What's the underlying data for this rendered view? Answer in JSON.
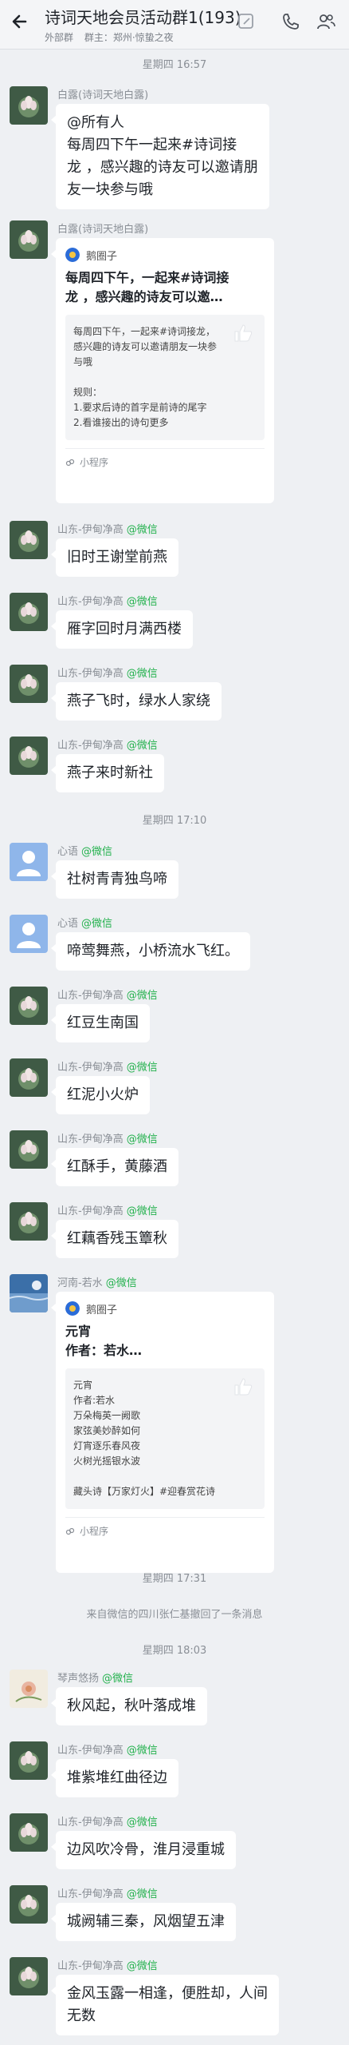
{
  "header": {
    "title": "诗词天地会员活动群1(193)",
    "subtitle_left": "外部群",
    "subtitle_right": "群主：郑州·惊蛰之夜",
    "accent": "#2b6cd8"
  },
  "timestamps": [
    "星期四 16:57",
    "星期四 17:10",
    "星期四 17:31",
    "星期四 18:03"
  ],
  "notice": "来自微信的四川张仁基撤回了一条消息",
  "wechat_tag": "@微信",
  "messages": [
    {
      "sender": "白露(诗词天地白露)",
      "text": [
        "@所有人",
        "每周四下午一起来#诗词接",
        "龙 ，感兴趣的诗友可以邀请朋",
        "友一块参与哦"
      ]
    },
    {
      "sender": "白露(诗词天地白露)",
      "card": {
        "source": "鹅圈子",
        "title": [
          "每周四下午，一起来#诗词接",
          "龙     ，感兴趣的诗友可以邀…"
        ],
        "preview": [
          "每周四下午，一起来#诗词接龙，",
          "感兴趣的诗友可以邀请朋友一块参",
          "与哦",
          "",
          "规则：",
          "1.要求后诗的首字是前诗的尾字",
          "2.看谁接出的诗句更多"
        ],
        "footer": "小程序"
      }
    },
    {
      "sender": "山东-伊甸净高",
      "text": [
        "旧时王谢堂前燕"
      ]
    },
    {
      "sender": "山东-伊甸净高",
      "text": [
        "雁字回时月满西楼"
      ]
    },
    {
      "sender": "山东-伊甸净高",
      "text": [
        "燕子飞时，绿水人家绕"
      ]
    },
    {
      "sender": "山东-伊甸净高",
      "text": [
        "燕子来时新社"
      ]
    },
    {
      "sender": "心语",
      "text": [
        "社树青青独鸟啼"
      ]
    },
    {
      "sender": "心语",
      "text": [
        "啼莺舞燕，小桥流水飞红。"
      ]
    },
    {
      "sender": "山东-伊甸净高",
      "text": [
        "红豆生南国"
      ]
    },
    {
      "sender": "山东-伊甸净高",
      "text": [
        "红泥小火炉"
      ]
    },
    {
      "sender": "山东-伊甸净高",
      "text": [
        "红酥手，黄藤酒"
      ]
    },
    {
      "sender": "山东-伊甸净高",
      "text": [
        "红藕香残玉簟秋"
      ]
    },
    {
      "sender": "河南-若水",
      "card": {
        "source": "鹅圈子",
        "title": [
          "元宵",
          "作者：若水…"
        ],
        "preview": [
          "元宵",
          "作者:若水",
          "万朵梅英一阙歌",
          "家弦美妙醉如何",
          "灯宵逐乐春风夜",
          "火树光摇银水波",
          "",
          "藏头诗【万家灯火】#迎春赏花诗"
        ],
        "footer": "小程序"
      }
    },
    {
      "sender": "琴声悠扬",
      "text": [
        "秋风起，秋叶落成堆"
      ]
    },
    {
      "sender": "山东-伊甸净高",
      "text": [
        "堆紫堆红曲径边"
      ]
    },
    {
      "sender": "山东-伊甸净高",
      "text": [
        "边风吹冷骨，淮月浸重城"
      ]
    },
    {
      "sender": "山东-伊甸净高",
      "text": [
        "城阙辅三秦，风烟望五津"
      ]
    },
    {
      "sender": "山东-伊甸净高",
      "text": [
        "金风玉露一相逢，便胜却，人间",
        "无数"
      ]
    }
  ]
}
